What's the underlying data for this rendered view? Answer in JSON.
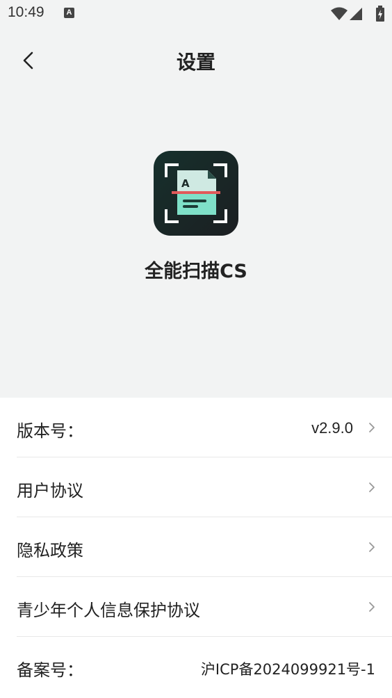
{
  "status_bar": {
    "time": "10:49",
    "notification_icon": "A"
  },
  "header": {
    "title": "设置",
    "back_icon": "chevron-left-icon"
  },
  "app": {
    "name": "全能扫描CS",
    "logo_letter": "A",
    "colors": {
      "logo_bg": "#1d2b2b",
      "doc": "#7fe0c8",
      "scan_line": "#e15a5a"
    }
  },
  "settings": {
    "version_label": "版本号：",
    "version_value": "v2.9.0",
    "user_agreement": "用户协议",
    "privacy_policy": "隐私政策",
    "minor_protection": "青少年个人信息保护协议",
    "icp_label": "备案号：",
    "icp_value": "沪ICP备2024099921号-1"
  }
}
